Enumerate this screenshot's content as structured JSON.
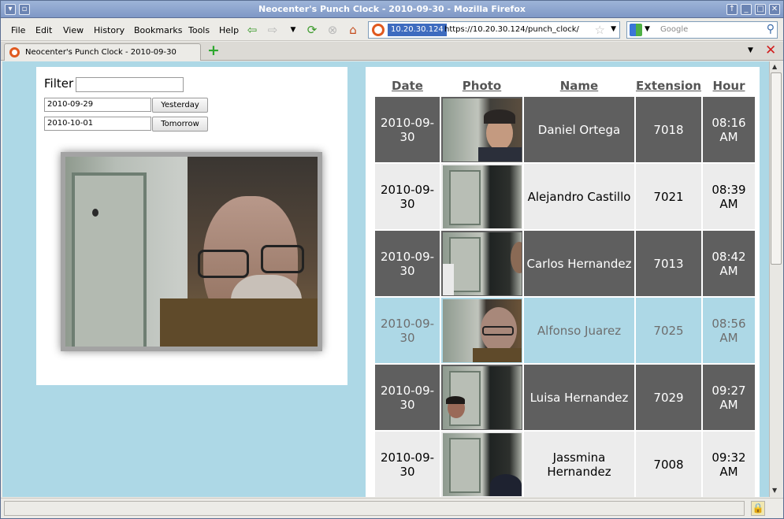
{
  "window": {
    "title": "Neocenter's Punch Clock - 2010-09-30 - Mozilla Firefox"
  },
  "menu": [
    "File",
    "Edit",
    "View",
    "History",
    "Bookmarks",
    "Tools",
    "Help"
  ],
  "address": {
    "host": "10.20.30.124",
    "url": "https://10.20.30.124/punch_clock/"
  },
  "search": {
    "placeholder": "Google"
  },
  "tab": {
    "label": "Neocenter's Punch Clock - 2010-09-30"
  },
  "filter": {
    "label": "Filter",
    "value": "",
    "from_date": "2010-09-29",
    "yesterday_label": "Yesterday",
    "to_date": "2010-10-01",
    "tomorrow_label": "Tomorrow"
  },
  "table": {
    "headers": [
      "Date",
      "Photo",
      "Name",
      "Extension",
      "Hour"
    ],
    "rows": [
      {
        "date": "2010-09-30",
        "name": "Daniel Ortega",
        "ext": "7018",
        "hour": "08:16 AM",
        "style": "dark"
      },
      {
        "date": "2010-09-30",
        "name": "Alejandro Castillo",
        "ext": "7021",
        "hour": "08:39 AM",
        "style": "light"
      },
      {
        "date": "2010-09-30",
        "name": "Carlos Hernandez",
        "ext": "7013",
        "hour": "08:42 AM",
        "style": "dark"
      },
      {
        "date": "2010-09-30",
        "name": "Alfonso Juarez",
        "ext": "7025",
        "hour": "08:56 AM",
        "style": "hl"
      },
      {
        "date": "2010-09-30",
        "name": "Luisa Hernandez",
        "ext": "7029",
        "hour": "09:27 AM",
        "style": "dark"
      },
      {
        "date": "2010-09-30",
        "name": "Jassmina Hernandez",
        "ext": "7008",
        "hour": "09:32 AM",
        "style": "light"
      }
    ]
  },
  "colors": {
    "page_bg": "#add8e6",
    "dark_row": "#5f5f5f",
    "light_row": "#ececec",
    "highlight_row": "#add8e6"
  }
}
